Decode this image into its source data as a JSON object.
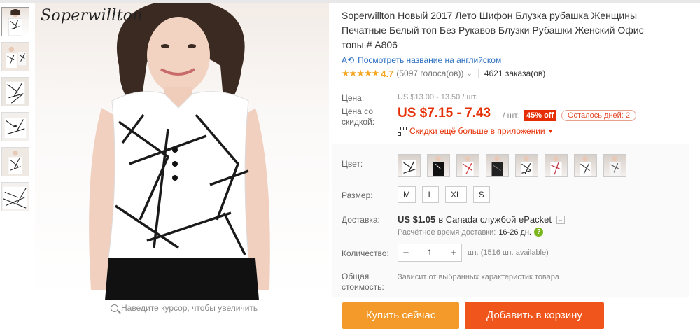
{
  "brand_logo": "Soperwillton",
  "zoom_hint": "Наведите курсор, чтобы увеличить",
  "product": {
    "title": "Soperwillton Новый 2017 Лето Шифон Блузка рубашка Женщины Печатные Белый топ Без Рукавов Блузки Рубашки Женский Офис топы # A806",
    "translate_link": "Посмотреть название на английском",
    "translate_icon": "translate-icon",
    "stars": "★★★★★",
    "rating": "4.7",
    "votes": "(5097 голоса(ов))",
    "orders": "4621 заказа(ов)"
  },
  "price": {
    "label": "Цена:",
    "old": "US $13.00 - 13.50 / шт.",
    "discount_label": "Цена со скидкой:",
    "new": "US $7.15 - 7.43",
    "per_unit": "/ шт.",
    "discount_badge": "45% off",
    "days_left": "Осталось дней: 2",
    "app_promo": "Скидки ещё больше в приложении",
    "accent_color": "#e62e04"
  },
  "options": {
    "color_label": "Цвет:",
    "swatch_count_note": "8",
    "size_label": "Размер:",
    "sizes": [
      "M",
      "L",
      "XL",
      "S"
    ]
  },
  "shipping": {
    "label": "Доставка:",
    "price": "US $1.05",
    "destination": "в Canada службой ePacket",
    "time_label": "Расчётное время доставки:",
    "time_value": "16-26 дн.",
    "help": "?"
  },
  "quantity": {
    "label": "Количество:",
    "minus": "−",
    "value": "1",
    "plus": "+",
    "available": "шт. (1516 шт. available)"
  },
  "total": {
    "label": "Общая стоимость:",
    "value": "Зависит от выбранных характеристик товара"
  },
  "buttons": {
    "buy_now": "Купить сейчас",
    "add_to_cart": "Добавить в корзину",
    "buy_color": "#f39a2b",
    "cart_color": "#f0561c"
  }
}
